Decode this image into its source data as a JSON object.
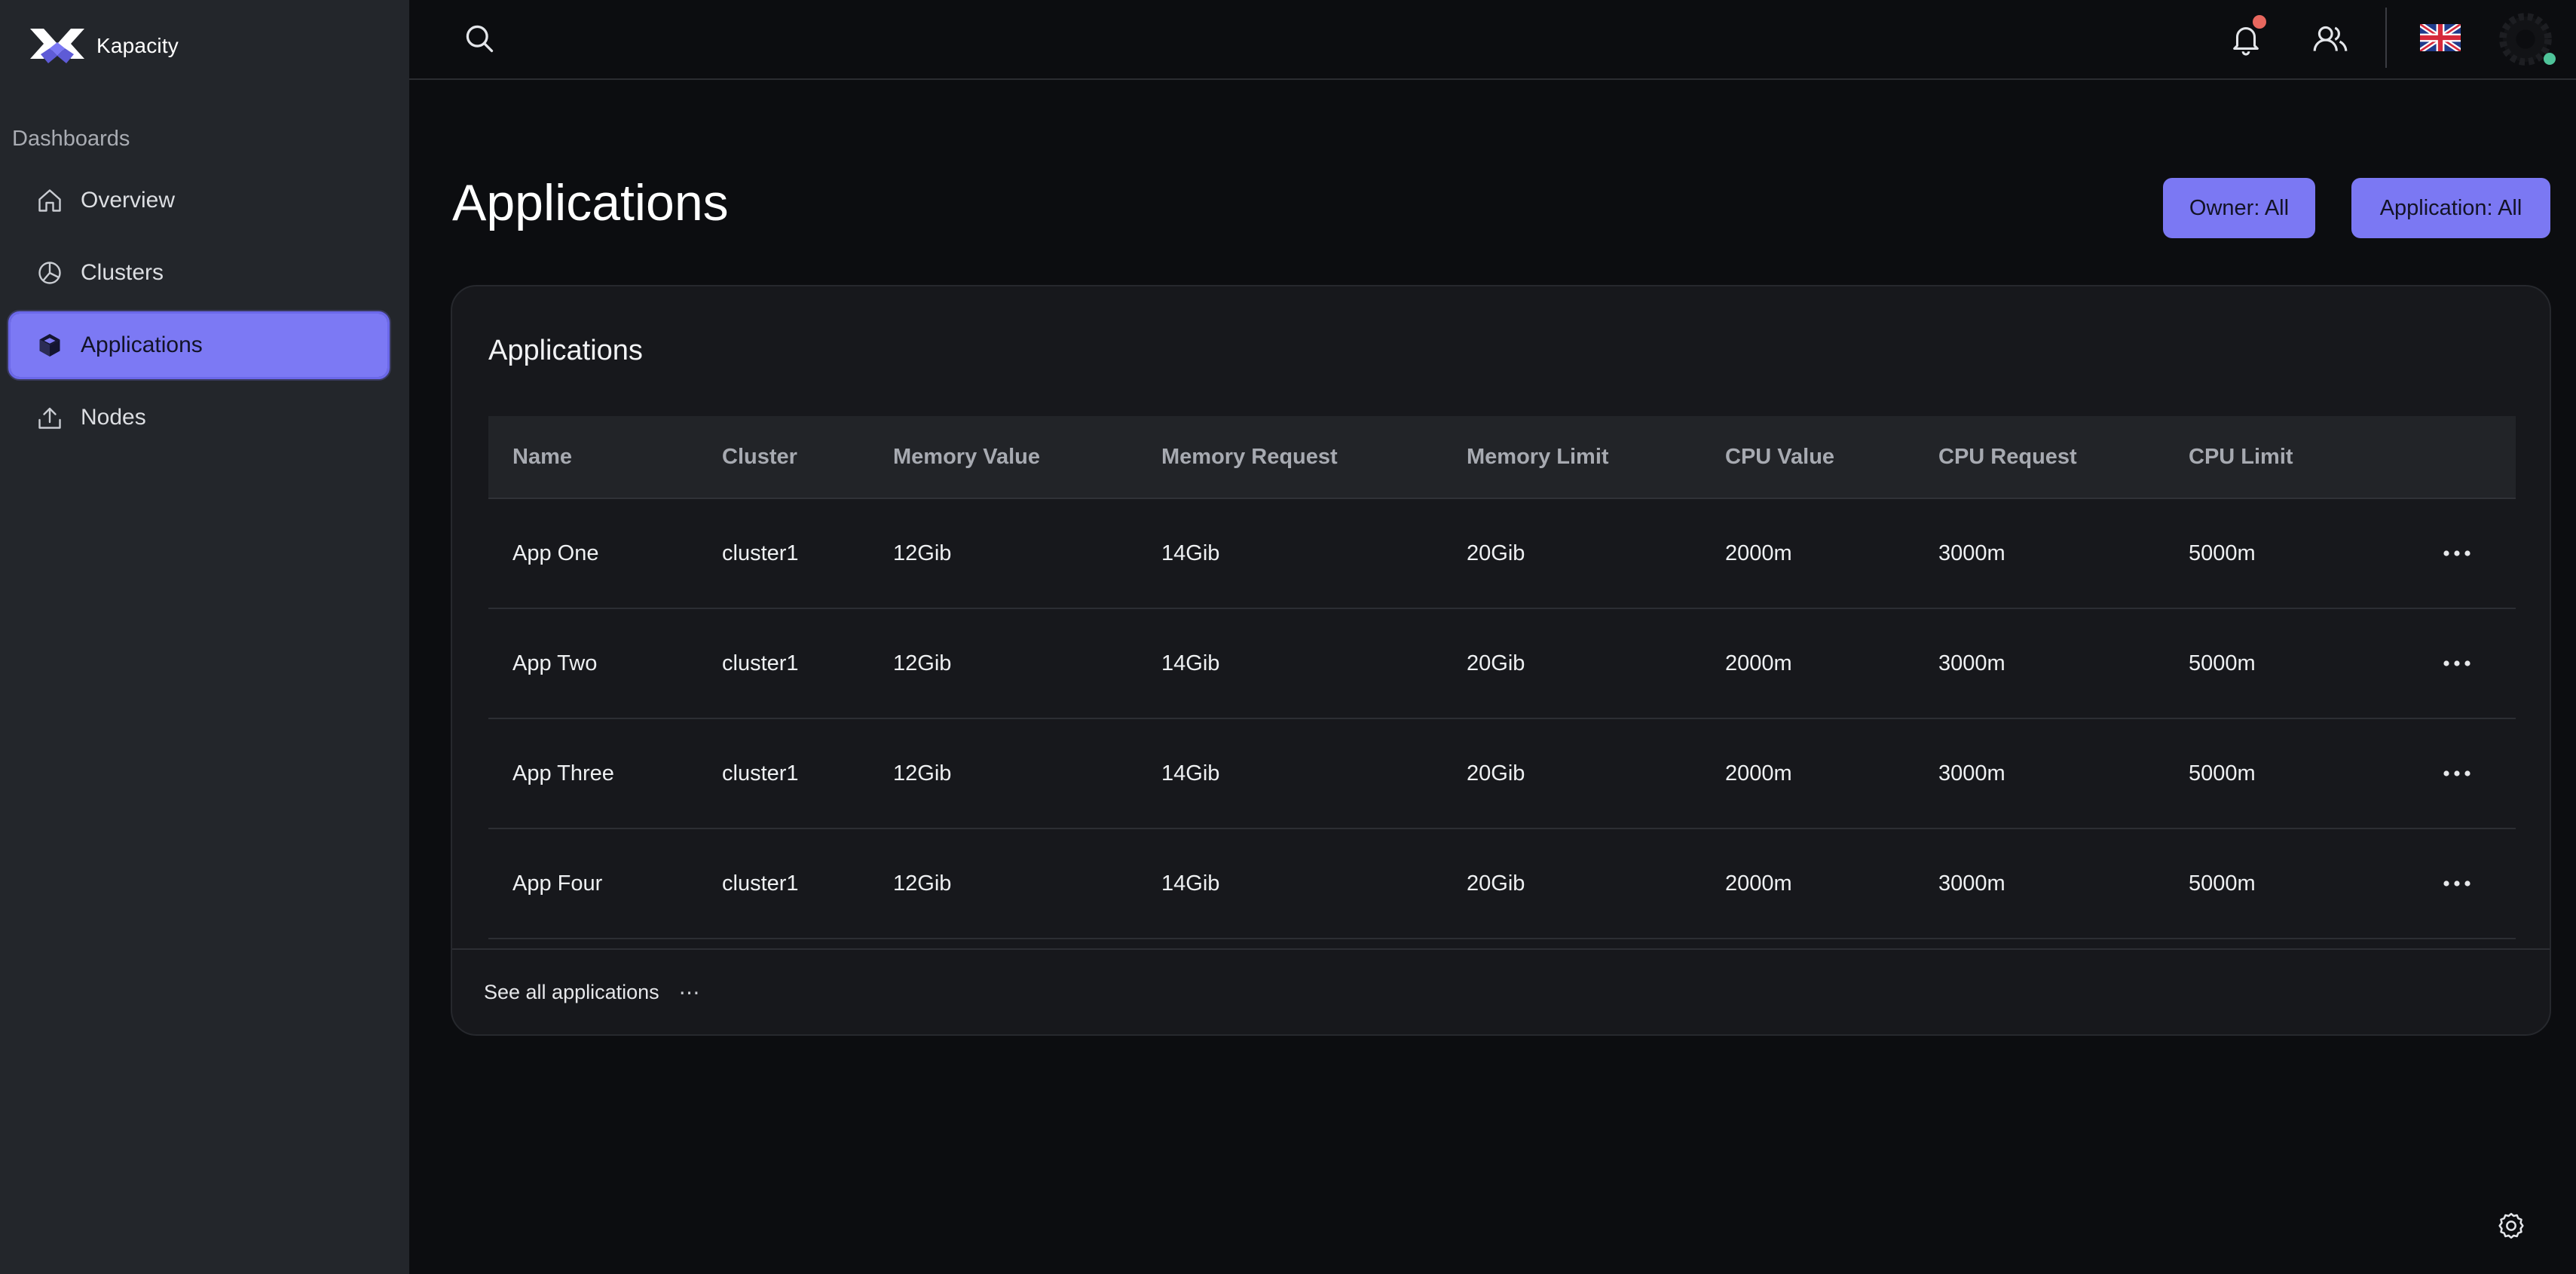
{
  "brand": {
    "name": "Kapacity"
  },
  "sidebar": {
    "section_label": "Dashboards",
    "items": [
      {
        "label": "Overview",
        "icon": "home-icon",
        "active": false
      },
      {
        "label": "Clusters",
        "icon": "pie-chart-icon",
        "active": false
      },
      {
        "label": "Applications",
        "icon": "cube-icon",
        "active": true
      },
      {
        "label": "Nodes",
        "icon": "upload-icon",
        "active": false
      }
    ]
  },
  "topbar": {
    "icons": [
      "search-icon",
      "bell-icon",
      "users-icon",
      "uk-flag-icon",
      "avatar"
    ],
    "notification_dot_color": "#e8675e",
    "status_dot_color": "#4fc49a"
  },
  "page": {
    "title": "Applications",
    "filters": {
      "owner": "Owner: All",
      "application": "Application: All"
    },
    "accent_color": "#7b78f3"
  },
  "card": {
    "title": "Applications",
    "columns": [
      "Name",
      "Cluster",
      "Memory Value",
      "Memory Request",
      "Memory Limit",
      "CPU Value",
      "CPU Request",
      "CPU Limit"
    ],
    "rows": [
      [
        "App One",
        "cluster1",
        "12Gib",
        "14Gib",
        "20Gib",
        "2000m",
        "3000m",
        "5000m"
      ],
      [
        "App Two",
        "cluster1",
        "12Gib",
        "14Gib",
        "20Gib",
        "2000m",
        "3000m",
        "5000m"
      ],
      [
        "App Three",
        "cluster1",
        "12Gib",
        "14Gib",
        "20Gib",
        "2000m",
        "3000m",
        "5000m"
      ],
      [
        "App Four",
        "cluster1",
        "12Gib",
        "14Gib",
        "20Gib",
        "2000m",
        "3000m",
        "5000m"
      ]
    ],
    "footer": {
      "link": "See all applications",
      "more": "⋯"
    }
  }
}
